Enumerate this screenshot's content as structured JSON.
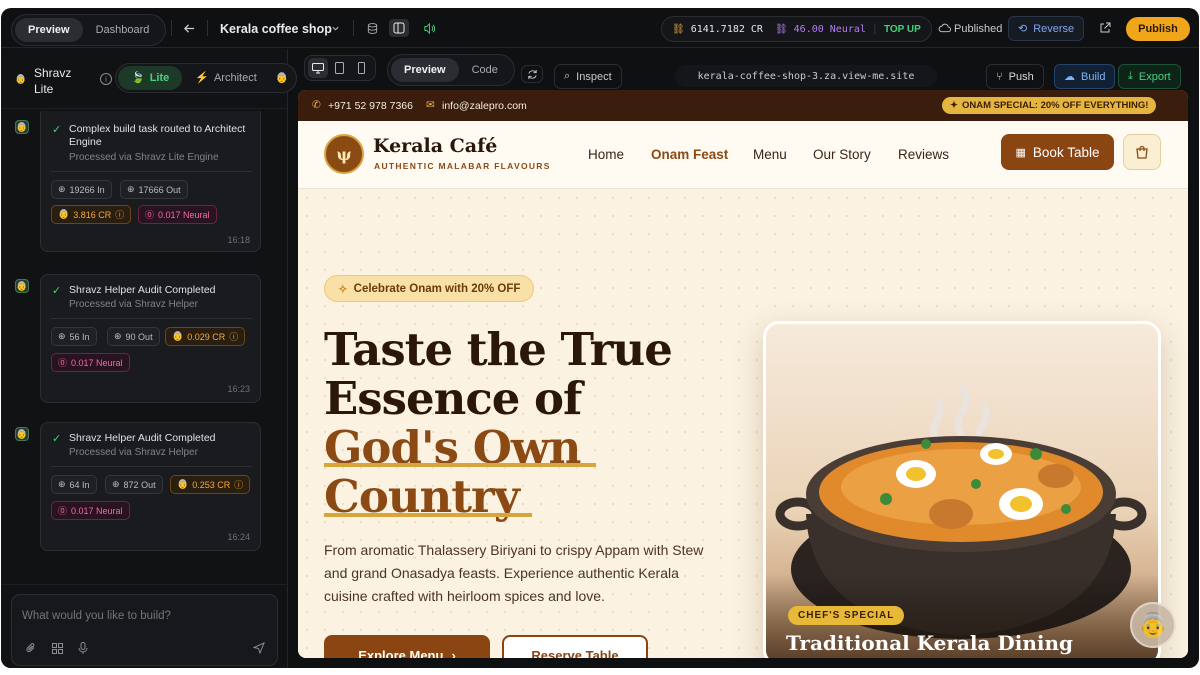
{
  "topbar": {
    "mode_tabs": [
      "Preview",
      "Dashboard"
    ],
    "project_name": "Kerala coffee shop",
    "credits_cr": "6141.7182 CR",
    "neural": "46.00 Neural",
    "top_up": "TOP UP",
    "published_label": "Published",
    "reverse_label": "Reverse",
    "publish_label": "Publish"
  },
  "sidebar": {
    "user_name": "Shravz Lite",
    "engine_tabs": [
      "Lite",
      "Architect"
    ],
    "cards": [
      {
        "title": "Complex build task routed to Architect Engine",
        "subtitle": "Processed via Shravz Lite Engine",
        "tokens_in": "19266 In",
        "tokens_out": "17666 Out",
        "cr": "3.816 CR",
        "neural": "0.017 Neural",
        "time": "16:18"
      },
      {
        "title": "Shravz Helper Audit Completed",
        "subtitle": "Processed via Shravz Helper",
        "tokens_in": "56 In",
        "tokens_out": "90 Out",
        "cr": "0.029 CR",
        "neural": "0.017 Neural",
        "time": "16:23"
      },
      {
        "title": "Shravz Helper Audit Completed",
        "subtitle": "Processed via Shravz Helper",
        "tokens_in": "64 In",
        "tokens_out": "872 Out",
        "cr": "0.253 CR",
        "neural": "0.017 Neural",
        "time": "16:24"
      }
    ],
    "composer_placeholder": "What would you like to build?"
  },
  "preview_toolbar": {
    "view_tabs": [
      "Preview",
      "Code"
    ],
    "inspect_label": "Inspect",
    "url": "kerala-coffee-shop-3.za.view-me.site",
    "push_label": "Push",
    "build_label": "Build",
    "export_label": "Export"
  },
  "site": {
    "phone": "+971 52 978 7366",
    "email": "info@zalepro.com",
    "promo": "ONAM SPECIAL: 20% OFF EVERYTHING!",
    "brand_name": "Kerala Café",
    "brand_tagline": "AUTHENTIC MALABAR FLAVOURS",
    "nav": [
      "Home",
      "Onam Feast",
      "Menu",
      "Our Story",
      "Reviews"
    ],
    "book_label": "Book Table",
    "hero_badge": "Celebrate Onam with 20% OFF",
    "headline": [
      "Taste the True",
      "Essence of",
      "God's Own",
      "Country"
    ],
    "paragraph": "From aromatic Thalassery Biriyani to crispy Appam with Stew and grand Onasadya feasts. Experience authentic Kerala cuisine crafted with heirloom spices and love.",
    "cta_primary": "Explore Menu",
    "cta_secondary": "Reserve Table",
    "chef_badge": "CHEF'S SPECIAL",
    "dish_title": "Traditional Kerala Dining"
  },
  "colors": {
    "accent_brown": "#8b4513",
    "publish_orange": "#f0a51a",
    "lite_green": "#4ccf7e",
    "neural_pink": "#f06aa6"
  }
}
